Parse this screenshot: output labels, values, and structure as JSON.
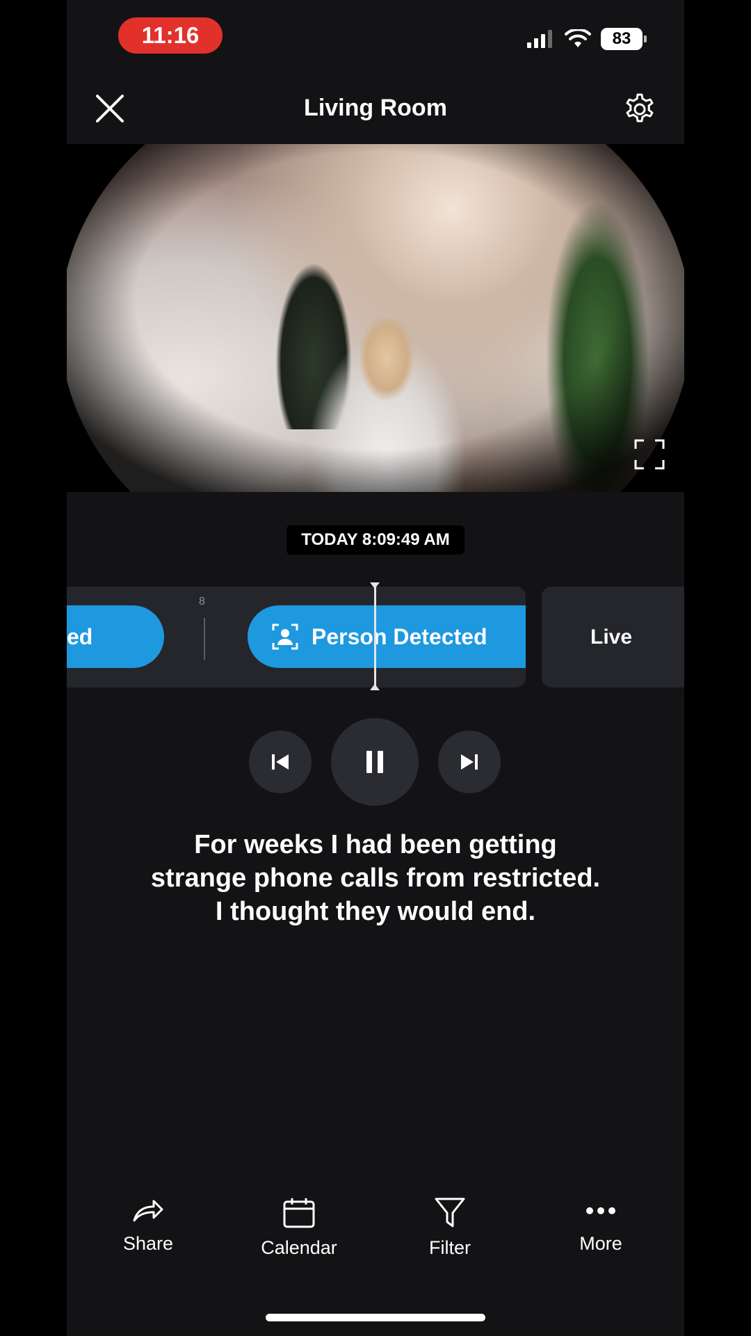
{
  "status_bar": {
    "time": "11:16",
    "battery": "83"
  },
  "header": {
    "title": "Living Room"
  },
  "player": {
    "timestamp": "TODAY 8:09:49 AM"
  },
  "timeline": {
    "hour_label": "8",
    "previous_event_label": "ed",
    "current_event_label": "Person Detected",
    "live_label": "Live"
  },
  "caption": {
    "lines": [
      "For weeks I had been getting",
      "strange phone calls from restricted.",
      "I thought they would end."
    ]
  },
  "bottom_nav": {
    "items": [
      {
        "label": "Share",
        "icon": "share-icon"
      },
      {
        "label": "Calendar",
        "icon": "calendar-icon"
      },
      {
        "label": "Filter",
        "icon": "filter-icon"
      },
      {
        "label": "More",
        "icon": "more-icon"
      }
    ]
  },
  "colors": {
    "event_blue": "#1e98de",
    "time_pill_red": "#e2312a",
    "background": "#131316"
  }
}
